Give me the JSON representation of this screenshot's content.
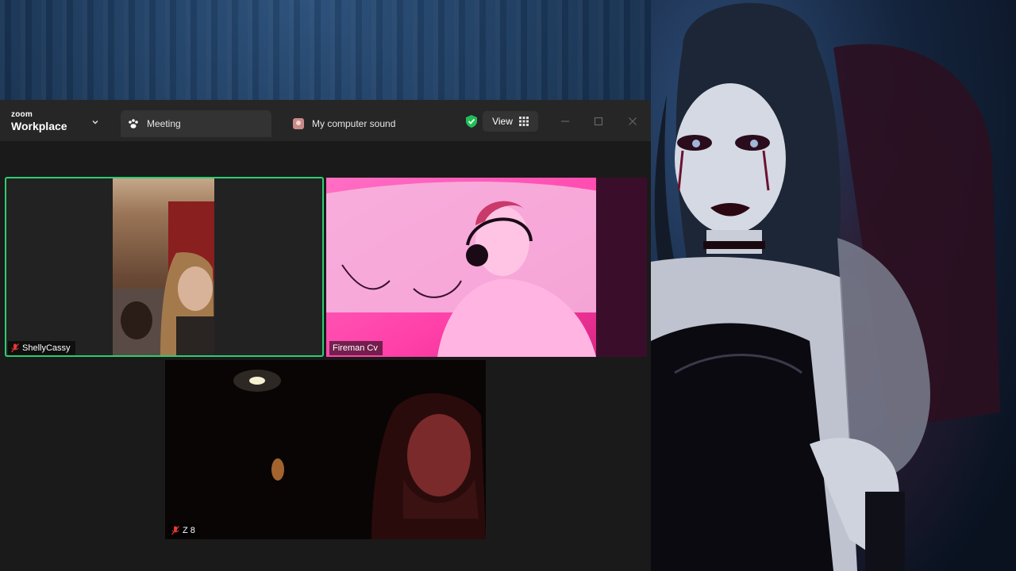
{
  "zoom": {
    "brand_small": "zoom",
    "brand_large": "Workplace",
    "tabs": [
      {
        "label": "Meeting"
      },
      {
        "label": "My computer sound"
      }
    ],
    "view_label": "View",
    "accent_color": "#2ecc71"
  },
  "participants": [
    {
      "name": "ShellyCassy",
      "muted": true,
      "active_speaker": true
    },
    {
      "name": "Fireman Cv",
      "muted": false
    },
    {
      "name": "Z 8",
      "muted": true
    }
  ]
}
